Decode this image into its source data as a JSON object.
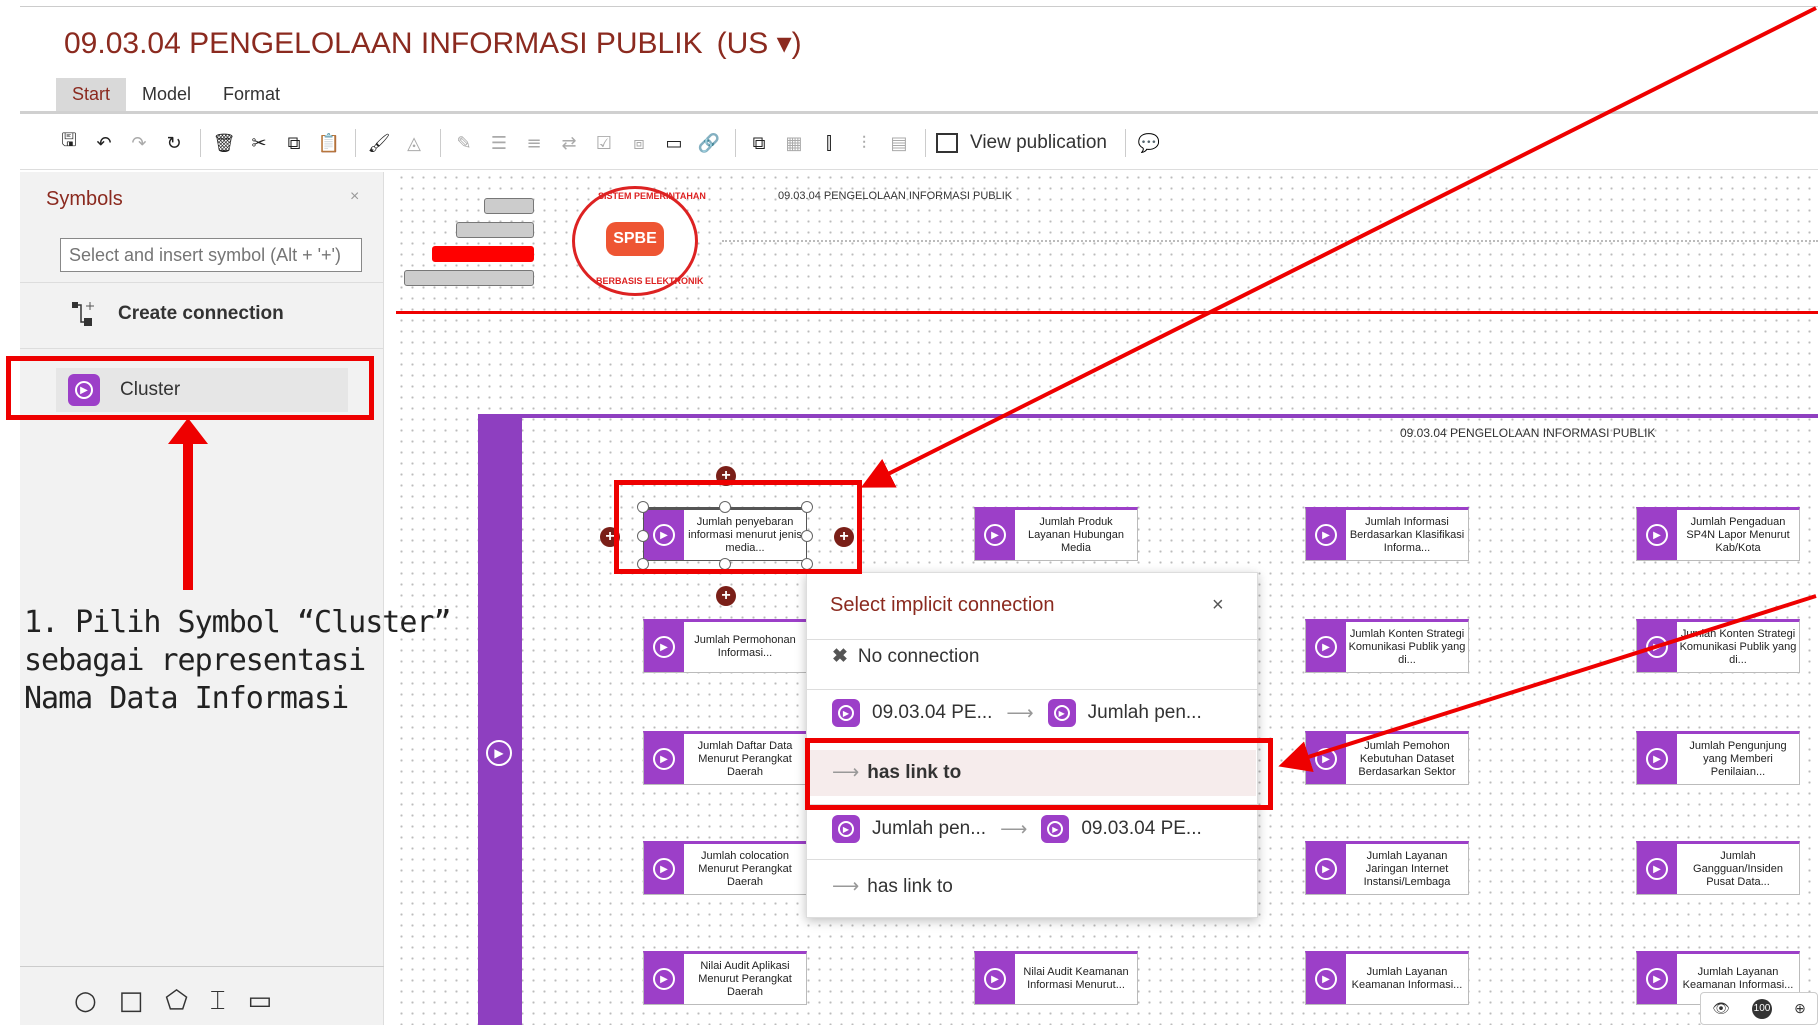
{
  "document": {
    "title": "09.03.04 PENGELOLAAN INFORMASI PUBLIK",
    "language": "(US ▾)"
  },
  "menu": {
    "tabs": [
      "Start",
      "Model",
      "Format"
    ],
    "active": "Start"
  },
  "toolbar": {
    "view_publication": "View publication"
  },
  "sidebar": {
    "header": "Symbols",
    "close": "×",
    "search_placeholder": "Select and insert symbol (Alt + '+')",
    "create_connection": "Create connection",
    "cluster_label": "Cluster"
  },
  "annotation": {
    "step_line1": "1. Pilih Symbol “Cluster”",
    "step_line2": "sebagai representasi",
    "step_line3": "Nama Data Informasi"
  },
  "canvas": {
    "header_text": "09.03.04 PENGELOLAAN INFORMASI PUBLIK",
    "seal_text": "SPBE",
    "seal_top": "SISTEM PEMERINTAHAN",
    "seal_bottom": "BERBASIS ELEKTRONIK",
    "pool_title": "09.03.04 PENGELOLAAN INFORMASI PUBLIK"
  },
  "nodes": [
    "Jumlah penyebaran informasi menurut jenis media...",
    "Jumlah Produk Layanan Hubungan Media",
    "Jumlah Informasi Berdasarkan Klasifikasi Informa...",
    "Jumlah Pengaduan SP4N Lapor Menurut Kab/Kota",
    "Jumlah Permohonan Informasi...",
    "Jumlah Konten Strategi Komunikasi Publik yang di...",
    "Jumlah Konten Strategi Komunikasi Publik yang di...",
    "Jumlah Daftar Data Menurut Perangkat Daerah",
    "Jumlah Pemohon Kebutuhan Dataset Berdasarkan Sektor",
    "Jumlah Pengunjung yang Memberi Penilaian...",
    "Jumlah colocation Menurut Perangkat Daerah",
    "Jumlah Layanan Jaringan Internet Instansi/Lembaga",
    "Jumlah Gangguan/Insiden Pusat Data...",
    "Nilai Audit Aplikasi Menurut Perangkat Daerah",
    "Nilai Audit Keamanan Informasi Menurut...",
    "Jumlah Layanan Keamanan Informasi...",
    "Jumlah Layanan Keamanan Informasi..."
  ],
  "popup": {
    "title": "Select implicit connection",
    "close": "×",
    "no_connection": "No connection",
    "row1_from": "09.03.04 PE...",
    "row1_to": "Jumlah pen...",
    "row1_rel": "has link to",
    "row2_from": "Jumlah pen...",
    "row2_to": "09.03.04 PE...",
    "row2_rel": "has link to",
    "arrow": "⟶"
  },
  "zoom": {
    "value": "100"
  },
  "colors": {
    "accent": "#8b2a1f",
    "cluster": "#9c3fc8",
    "annotation": "#e00000"
  }
}
